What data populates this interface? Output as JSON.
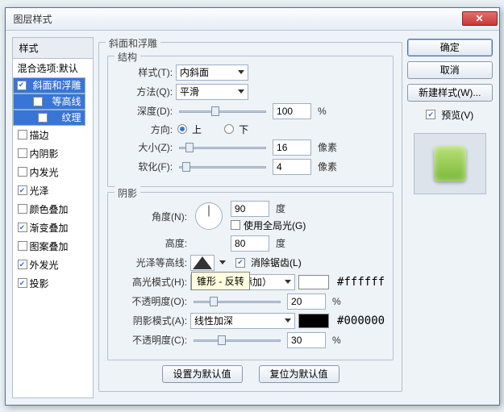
{
  "title": "图层样式",
  "left": {
    "header": "样式",
    "blend": "混合选项:默认",
    "items": [
      {
        "label": "斜面和浮雕",
        "checked": true,
        "sel": true,
        "indent": 0
      },
      {
        "label": "等高线",
        "checked": false,
        "sel": true,
        "indent": 1
      },
      {
        "label": "纹理",
        "checked": false,
        "sel": true,
        "indent": 1
      },
      {
        "label": "描边",
        "checked": false,
        "sel": false,
        "indent": 0
      },
      {
        "label": "内阴影",
        "checked": false,
        "sel": false,
        "indent": 0
      },
      {
        "label": "内发光",
        "checked": false,
        "sel": false,
        "indent": 0
      },
      {
        "label": "光泽",
        "checked": true,
        "sel": false,
        "indent": 0
      },
      {
        "label": "颜色叠加",
        "checked": false,
        "sel": false,
        "indent": 0
      },
      {
        "label": "渐变叠加",
        "checked": true,
        "sel": false,
        "indent": 0
      },
      {
        "label": "图案叠加",
        "checked": false,
        "sel": false,
        "indent": 0
      },
      {
        "label": "外发光",
        "checked": true,
        "sel": false,
        "indent": 0
      },
      {
        "label": "投影",
        "checked": true,
        "sel": false,
        "indent": 0
      }
    ]
  },
  "panel_title": "斜面和浮雕",
  "structure": {
    "legend": "结构",
    "style_label": "样式(T):",
    "style_value": "内斜面",
    "tech_label": "方法(Q):",
    "tech_value": "平滑",
    "depth_label": "深度(D):",
    "depth_value": "100",
    "depth_unit": "%",
    "dir_label": "方向:",
    "up": "上",
    "down": "下",
    "size_label": "大小(Z):",
    "size_value": "16",
    "size_unit": "像素",
    "soft_label": "软化(F):",
    "soft_value": "4",
    "soft_unit": "像素"
  },
  "shading": {
    "legend": "阴影",
    "angle_label": "角度(N):",
    "angle_value": "90",
    "angle_unit": "度",
    "global_label": "使用全局光(G)",
    "global_checked": false,
    "alt_label": "高度:",
    "alt_value": "80",
    "alt_unit": "度",
    "gloss_label": "光泽等高线:",
    "gloss_tooltip": "锥形 - 反转",
    "aa_label": "消除锯齿(L)",
    "aa_checked": true,
    "hi_mode_label": "高光模式(H):",
    "hi_mode_value": "线性减淡（添加）",
    "hi_color": "#ffffff",
    "hi_hex": "#ffffff",
    "hi_op_label": "不透明度(O):",
    "hi_op_value": "20",
    "op_unit": "%",
    "sh_mode_label": "阴影模式(A):",
    "sh_mode_value": "线性加深",
    "sh_color": "#000000",
    "sh_hex": "#000000",
    "sh_op_label": "不透明度(C):",
    "sh_op_value": "30"
  },
  "footer": {
    "make_default": "设置为默认值",
    "reset_default": "复位为默认值"
  },
  "right": {
    "ok": "确定",
    "cancel": "取消",
    "new_style": "新建样式(W)...",
    "preview": "预览(V)",
    "preview_checked": true
  },
  "chart_data": {
    "type": "table",
    "note": "no chart present"
  }
}
